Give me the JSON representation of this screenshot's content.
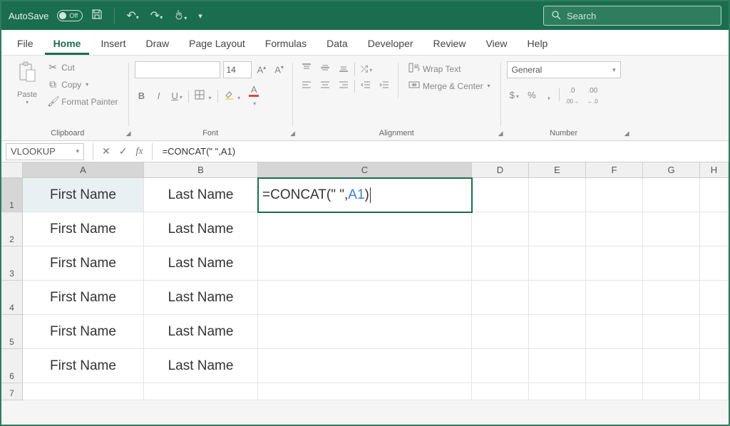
{
  "titlebar": {
    "autosave_label": "AutoSave",
    "autosave_state": "Off",
    "search_placeholder": "Search"
  },
  "tabs": {
    "file": "File",
    "home": "Home",
    "insert": "Insert",
    "draw": "Draw",
    "page_layout": "Page Layout",
    "formulas": "Formulas",
    "data": "Data",
    "developer": "Developer",
    "review": "Review",
    "view": "View",
    "help": "Help"
  },
  "ribbon": {
    "paste": "Paste",
    "cut": "Cut",
    "copy": "Copy",
    "format_painter": "Format Painter",
    "clipboard_label": "Clipboard",
    "font_size": "14",
    "font_label": "Font",
    "wrap_text": "Wrap Text",
    "merge_center": "Merge & Center",
    "alignment_label": "Alignment",
    "number_format": "General",
    "number_label": "Number"
  },
  "formula_bar": {
    "name_box": "VLOOKUP",
    "formula_text_prefix": "=CONCAT(\"      \",",
    "formula_text_ref": "A1",
    "formula_text_suffix": ")",
    "formula_plain": "=CONCAT(\"      \",A1)"
  },
  "grid": {
    "columns": [
      "A",
      "B",
      "C",
      "D",
      "E",
      "F",
      "G",
      "H"
    ],
    "rows": [
      {
        "num": "1",
        "A": "First Name",
        "B": "Last Name",
        "C_prefix": "=CONCAT(\"      \",",
        "C_ref": "A1",
        "C_suffix": ")"
      },
      {
        "num": "2",
        "A": "First Name",
        "B": "Last Name"
      },
      {
        "num": "3",
        "A": "First Name",
        "B": "Last Name"
      },
      {
        "num": "4",
        "A": "First Name",
        "B": "Last Name"
      },
      {
        "num": "5",
        "A": "First Name",
        "B": "Last Name"
      },
      {
        "num": "6",
        "A": "First Name",
        "B": "Last Name"
      },
      {
        "num": "7"
      }
    ]
  }
}
